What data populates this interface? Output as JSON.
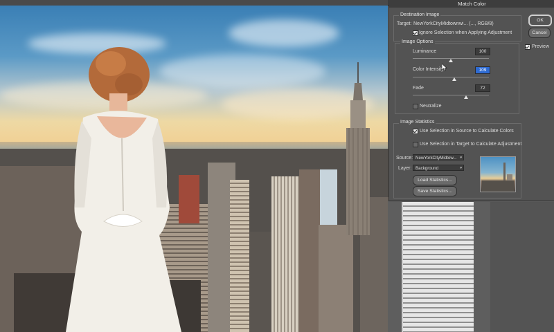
{
  "dialog": {
    "title": "Match Color",
    "ok_label": "OK",
    "cancel_label": "Cancel",
    "preview_label": "Preview",
    "preview_checked": true,
    "destination": {
      "heading": "Destination Image",
      "target_label": "Target:",
      "target_value": "NewYorkCityMidtownwi... (..., RGB/8)",
      "ignore_selection_label": "Ignore Selection when Applying Adjustment",
      "ignore_selection_checked": true
    },
    "image_options": {
      "heading": "Image Options",
      "luminance_label": "Luminance",
      "luminance_value": "100",
      "luminance_fraction": 0.5,
      "color_intensity_label": "Color Intensity",
      "color_intensity_value": "109",
      "color_intensity_fraction": 0.54,
      "fade_label": "Fade",
      "fade_value": "72",
      "fade_fraction": 0.72,
      "neutralize_label": "Neutralize",
      "neutralize_checked": false
    },
    "statistics": {
      "heading": "Image Statistics",
      "use_source_label": "Use Selection in Source to Calculate Colors",
      "use_source_checked": true,
      "use_target_label": "Use Selection in Target to Calculate Adjustment",
      "use_target_checked": false,
      "source_label": "Source:",
      "source_value": "NewYorkCityMidtow...",
      "layer_label": "Layer:",
      "layer_value": "Background",
      "load_label": "Load Statistics...",
      "save_label": "Save Statistics..."
    }
  },
  "colors": {
    "dialog_bg": "#535353",
    "title_bar": "#3d3d3d",
    "selection_blue": "#2e6bd3"
  },
  "icons": {
    "cursor": "arrow-cursor-icon",
    "dropdown": "chevron-down-icon"
  }
}
